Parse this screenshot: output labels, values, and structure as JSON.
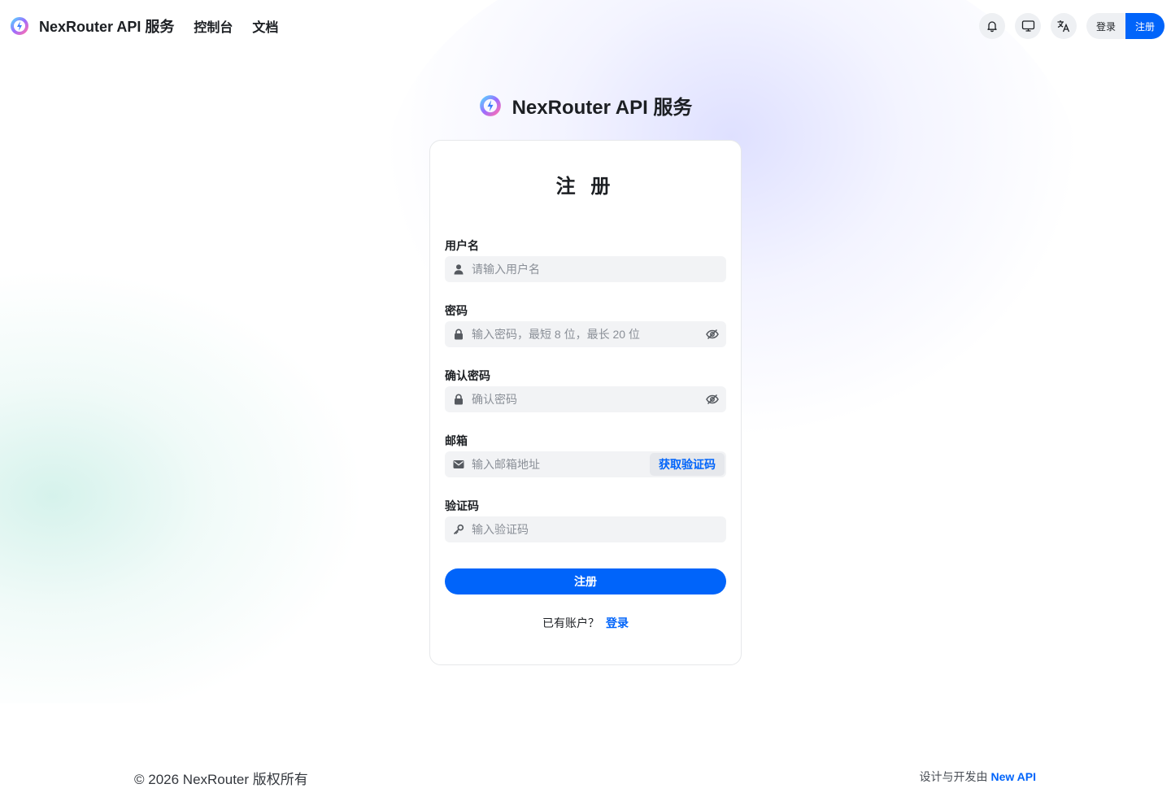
{
  "header": {
    "brand_name": "NexRouter API 服务",
    "nav": [
      "控制台",
      "文档"
    ],
    "icons": [
      "bell-icon",
      "monitor-icon",
      "translate-icon"
    ],
    "login_label": "登录",
    "register_label": "注册"
  },
  "center": {
    "brand_name": "NexRouter API 服务"
  },
  "form": {
    "title": "注 册",
    "username": {
      "label": "用户名",
      "placeholder": "请输入用户名"
    },
    "password": {
      "label": "密码",
      "placeholder": "输入密码，最短 8 位，最长 20 位"
    },
    "confirm_password": {
      "label": "确认密码",
      "placeholder": "确认密码"
    },
    "email": {
      "label": "邮箱",
      "placeholder": "输入邮箱地址",
      "code_button": "获取验证码"
    },
    "verification_code": {
      "label": "验证码",
      "placeholder": "输入验证码"
    },
    "submit_label": "注册",
    "have_account_text": "已有账户？",
    "login_link": "登录"
  },
  "footer": {
    "copyright": "© 2026 NexRouter 版权所有",
    "designed_by": "设计与开发由",
    "new_api_link": "New API"
  },
  "colors": {
    "accent": "#0064fa",
    "input_bg": "#f2f3f5",
    "text": "#1c1f23"
  }
}
